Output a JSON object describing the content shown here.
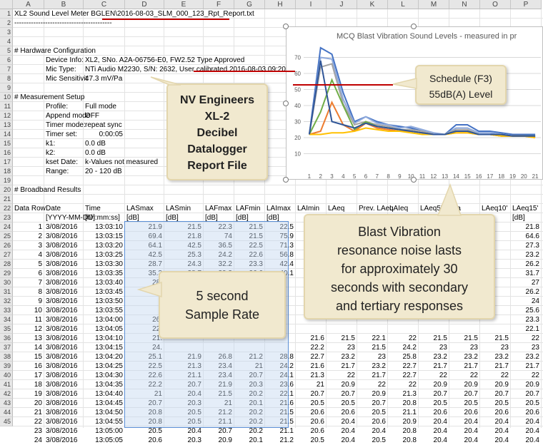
{
  "columns": [
    "A",
    "B",
    "C",
    "D",
    "E",
    "F",
    "G",
    "H",
    "I",
    "J",
    "K",
    "L",
    "M",
    "N",
    "O",
    "P"
  ],
  "header_rows": [
    {
      "row": 1,
      "cells": [
        {
          "col": "A",
          "text": "XL2 Sound Level Meter BGLEN\\2016-08-03_SLM_000_123_Rpt_Report.txt"
        }
      ]
    },
    {
      "row": 2,
      "cells": [
        {
          "col": "A",
          "text": "-----------------------------------------"
        }
      ]
    },
    {
      "row": 3,
      "cells": []
    },
    {
      "row": 4,
      "cells": []
    },
    {
      "row": 5,
      "cells": [
        {
          "col": "A",
          "text": "# Hardware Configuration"
        }
      ]
    },
    {
      "row": 6,
      "cells": [
        {
          "col": "B",
          "text": "Device Info:"
        },
        {
          "col": "C",
          "text": "XL2, SNo. A2A-06756-E0, FW2.52 Type Approved"
        }
      ]
    },
    {
      "row": 7,
      "cells": [
        {
          "col": "B",
          "text": "Mic Type:"
        },
        {
          "col": "C",
          "text": "NTi Audio M2230, S/N: 2632, User calibrated 2016-08-03  09:20"
        }
      ]
    },
    {
      "row": 8,
      "cells": [
        {
          "col": "B",
          "text": "Mic Sensitivit"
        },
        {
          "col": "C",
          "text": "47.3 mV/Pa"
        }
      ]
    },
    {
      "row": 9,
      "cells": []
    },
    {
      "row": 10,
      "cells": [
        {
          "col": "A",
          "text": "# Measurement Setup"
        }
      ]
    },
    {
      "row": 11,
      "cells": [
        {
          "col": "B",
          "text": "Profile:"
        },
        {
          "col": "C",
          "text": "Full mode"
        }
      ]
    },
    {
      "row": 12,
      "cells": [
        {
          "col": "B",
          "text": "Append mode"
        },
        {
          "col": "C",
          "text": "OFF"
        }
      ]
    },
    {
      "row": 13,
      "cells": [
        {
          "col": "B",
          "text": "Timer mode:"
        },
        {
          "col": "C",
          "text": "repeat sync"
        }
      ]
    },
    {
      "row": 14,
      "cells": [
        {
          "col": "B",
          "text": "Timer set:"
        },
        {
          "col": "C",
          "text": "0:00:05",
          "align": "right"
        }
      ]
    },
    {
      "row": 15,
      "cells": [
        {
          "col": "B",
          "text": "k1:"
        },
        {
          "col": "C",
          "text": "0.0 dB"
        }
      ]
    },
    {
      "row": 16,
      "cells": [
        {
          "col": "B",
          "text": "k2:"
        },
        {
          "col": "C",
          "text": "0.0 dB"
        }
      ]
    },
    {
      "row": 17,
      "cells": [
        {
          "col": "B",
          "text": "kset Date:"
        },
        {
          "col": "C",
          "text": "k-Values not measured"
        }
      ]
    },
    {
      "row": 18,
      "cells": [
        {
          "col": "B",
          "text": "Range:"
        },
        {
          "col": "C",
          "text": "20 - 120 dB"
        }
      ]
    },
    {
      "row": 19,
      "cells": []
    },
    {
      "row": 20,
      "cells": [
        {
          "col": "A",
          "text": "# Broadband Results"
        }
      ]
    },
    {
      "row": 21,
      "cells": []
    },
    {
      "row": 22,
      "cells": [
        {
          "col": "A",
          "text": "Data Row"
        },
        {
          "col": "B",
          "text": "Date"
        },
        {
          "col": "C",
          "text": "Time"
        },
        {
          "col": "D",
          "text": "LASmax"
        },
        {
          "col": "E",
          "text": "LASmin"
        },
        {
          "col": "F",
          "text": "LAFmax"
        },
        {
          "col": "G",
          "text": "LAFmin"
        },
        {
          "col": "H",
          "text": "LAImax"
        },
        {
          "col": "I",
          "text": "LAImin"
        },
        {
          "col": "J",
          "text": "LAeq"
        },
        {
          "col": "K",
          "text": "Prev. LAeq"
        },
        {
          "col": "L",
          "text": "LAIeq"
        },
        {
          "col": "M",
          "text": "LAeq5\""
        },
        {
          "col": "N",
          "text": "ma"
        },
        {
          "col": "O",
          "text": "LAeq10'"
        },
        {
          "col": "P",
          "text": "LAeq15'"
        }
      ]
    },
    {
      "row": 23,
      "cells": [
        {
          "col": "B",
          "text": "[YYYY-MM-DD]"
        },
        {
          "col": "C",
          "text": "[hh:mm:ss]"
        },
        {
          "col": "D",
          "text": "[dB]"
        },
        {
          "col": "E",
          "text": "[dB]"
        },
        {
          "col": "F",
          "text": "[dB]"
        },
        {
          "col": "G",
          "text": "[dB]"
        },
        {
          "col": "H",
          "text": "[dB]"
        },
        {
          "col": "P",
          "text": "[dB]"
        }
      ]
    }
  ],
  "data_rows": [
    {
      "row": 24,
      "v": [
        "1",
        "3/08/2016",
        "13:03:10",
        "21.9",
        "21.5",
        "22.3",
        "21.5",
        "22.5",
        "",
        "",
        "",
        "",
        "",
        "",
        "",
        "21.8"
      ]
    },
    {
      "row": 25,
      "v": [
        "2",
        "3/08/2016",
        "13:03:15",
        "69.4",
        "21.8",
        "74",
        "21.5",
        "75.9",
        "",
        "",
        "",
        "",
        "",
        "",
        "",
        "64.6"
      ]
    },
    {
      "row": 26,
      "v": [
        "3",
        "3/08/2016",
        "13:03:20",
        "64.1",
        "42.5",
        "36.5",
        "22.5",
        "71.3",
        "",
        "",
        "",
        "",
        "",
        "",
        "",
        "27.3"
      ]
    },
    {
      "row": 27,
      "v": [
        "4",
        "3/08/2016",
        "13:03:25",
        "42.5",
        "25.3",
        "24.2",
        "22.6",
        "56.8",
        "",
        "",
        "",
        "",
        "",
        "",
        "",
        "23.2"
      ]
    },
    {
      "row": 28,
      "v": [
        "5",
        "3/08/2016",
        "13:03:30",
        "28.7",
        "24.3",
        "32.2",
        "23.3",
        "42.4",
        "",
        "",
        "",
        "",
        "",
        "",
        "",
        "26.2"
      ]
    },
    {
      "row": 29,
      "v": [
        "6",
        "3/08/2016",
        "13:03:35",
        "35.3",
        "28.7",
        "39.3",
        "26.6",
        "40.1",
        "",
        "",
        "",
        "",
        "",
        "",
        "",
        "31.7"
      ]
    },
    {
      "row": 30,
      "v": [
        "7",
        "3/08/2016",
        "13:03:40",
        "28.",
        "",
        "",
        "",
        "",
        "",
        "",
        "",
        "",
        "",
        "",
        "",
        "27"
      ]
    },
    {
      "row": 31,
      "v": [
        "8",
        "3/08/2016",
        "13:03:45",
        "27.",
        "",
        "",
        "",
        "",
        "",
        "",
        "",
        "",
        "",
        "",
        "",
        "26.2"
      ]
    },
    {
      "row": 32,
      "v": [
        "9",
        "3/08/2016",
        "13:03:50",
        "",
        "",
        "",
        "",
        "",
        "",
        "",
        "",
        "",
        "",
        "",
        "",
        "24"
      ]
    },
    {
      "row": 33,
      "v": [
        "10",
        "3/08/2016",
        "13:03:55",
        "",
        "",
        "",
        "",
        "",
        "",
        "",
        "",
        "",
        "",
        "",
        "",
        "25.6"
      ]
    },
    {
      "row": 34,
      "v": [
        "11",
        "3/08/2016",
        "13:04:00",
        "26.",
        "",
        "",
        "",
        "",
        "",
        "",
        "",
        "",
        "",
        "",
        "",
        "23.3"
      ]
    },
    {
      "row": 35,
      "v": [
        "12",
        "3/08/2016",
        "13:04:05",
        "22.",
        "",
        "",
        "",
        "",
        "",
        "",
        "",
        "",
        "",
        "",
        "",
        "22.1"
      ]
    },
    {
      "row": 36,
      "v": [
        "13",
        "3/08/2016",
        "13:04:10",
        "21.",
        "",
        "",
        "",
        "",
        "21.6",
        "21.5",
        "22.1",
        "22",
        "21.5",
        "21.5",
        "21.5",
        "22"
      ]
    },
    {
      "row": 37,
      "v": [
        "14",
        "3/08/2016",
        "13:04:15",
        "24.",
        "",
        "",
        "",
        "",
        "22.2",
        "23",
        "21.5",
        "24.2",
        "23",
        "23",
        "23",
        "23"
      ]
    },
    {
      "row": 38,
      "v": [
        "15",
        "3/08/2016",
        "13:04:20",
        "25.1",
        "21.9",
        "26.8",
        "21.2",
        "28.8",
        "22.7",
        "23.2",
        "23",
        "25.8",
        "23.2",
        "23.2",
        "23.2",
        "23.2"
      ]
    },
    {
      "row": 39,
      "v": [
        "16",
        "3/08/2016",
        "13:04:25",
        "22.5",
        "21.3",
        "23.4",
        "21",
        "24.2",
        "21.6",
        "21.7",
        "23.2",
        "22.7",
        "21.7",
        "21.7",
        "21.7",
        "21.7"
      ]
    },
    {
      "row": 40,
      "v": [
        "17",
        "3/08/2016",
        "13:04:30",
        "22.6",
        "21.1",
        "23.4",
        "20.7",
        "24.1",
        "21.3",
        "22",
        "21.7",
        "22.7",
        "22",
        "22",
        "22",
        "22"
      ]
    },
    {
      "row": 41,
      "v": [
        "18",
        "3/08/2016",
        "13:04:35",
        "22.2",
        "20.7",
        "21.9",
        "20.3",
        "23.6",
        "21",
        "20.9",
        "22",
        "22",
        "20.9",
        "20.9",
        "20.9",
        "20.9"
      ]
    },
    {
      "row": 42,
      "v": [
        "19",
        "3/08/2016",
        "13:04:40",
        "21",
        "20.4",
        "21.5",
        "20.2",
        "22.1",
        "20.7",
        "20.7",
        "20.9",
        "21.3",
        "20.7",
        "20.7",
        "20.7",
        "20.7"
      ]
    },
    {
      "row": 43,
      "v": [
        "20",
        "3/08/2016",
        "13:04:45",
        "20.7",
        "20.3",
        "21",
        "20.1",
        "21.6",
        "20.5",
        "20.5",
        "20.7",
        "20.8",
        "20.5",
        "20.5",
        "20.5",
        "20.5"
      ]
    },
    {
      "row": 44,
      "v": [
        "21",
        "3/08/2016",
        "13:04:50",
        "20.8",
        "20.5",
        "21.2",
        "20.2",
        "21.5",
        "20.6",
        "20.6",
        "20.5",
        "21.1",
        "20.6",
        "20.6",
        "20.6",
        "20.6"
      ]
    },
    {
      "row": 45,
      "v": [
        "22",
        "3/08/2016",
        "13:04:55",
        "20.8",
        "20.5",
        "21.1",
        "20.2",
        "21.5",
        "20.6",
        "20.4",
        "20.6",
        "20.9",
        "20.4",
        "20.4",
        "20.4",
        "20.4"
      ]
    },
    {
      "row": 46,
      "v": [
        "23",
        "3/08/2016",
        "13:05:00",
        "20.5",
        "20.4",
        "20.7",
        "20.2",
        "21.1",
        "20.6",
        "20.4",
        "20.4",
        "20.8",
        "20.4",
        "20.4",
        "20.4",
        "20.4"
      ]
    },
    {
      "row": 47,
      "v": [
        "24",
        "3/08/2016",
        "13:05:05",
        "20.6",
        "20.3",
        "20.9",
        "20.1",
        "21.2",
        "20.5",
        "20.4",
        "20.5",
        "20.8",
        "20.4",
        "20.4",
        "20.4",
        "20.4"
      ]
    }
  ],
  "callouts": {
    "engineers": [
      "NV Engineers",
      "XL-2",
      "Decibel",
      "Datalogger",
      "Report File"
    ],
    "schedule": [
      "Schedule (F3)",
      "55dB(A) Level"
    ],
    "blast": [
      "Blast Vibration",
      "resonance noise lasts",
      "for approximately 30",
      "seconds with secondary",
      "and tertiary responses"
    ],
    "sample": [
      "5 second",
      "Sample Rate"
    ]
  },
  "chart_data": {
    "type": "line",
    "title": "MCQ Blast Vibration Sound Levels - measured in pr",
    "x": [
      1,
      2,
      3,
      4,
      5,
      6,
      7,
      8,
      9,
      10,
      11,
      12,
      13,
      14,
      15,
      16,
      17,
      18,
      19,
      20,
      21
    ],
    "ylim": [
      0,
      80
    ],
    "yticks": [
      10,
      20,
      30,
      40,
      50,
      60,
      70
    ],
    "grid": true,
    "series": [
      {
        "color": "#4472c4",
        "values": [
          22,
          76,
          72,
          48,
          30,
          33,
          30,
          28,
          27,
          26,
          24,
          22,
          22,
          28,
          28,
          24,
          24,
          23,
          22,
          22,
          22
        ]
      },
      {
        "color": "#8faadc",
        "values": [
          22,
          70,
          69,
          44,
          29,
          33,
          29,
          28,
          26,
          27,
          25,
          23,
          22,
          26,
          26,
          23,
          23,
          22,
          21,
          21,
          21
        ]
      },
      {
        "color": "#a5a5a5",
        "values": [
          22,
          64,
          66,
          41,
          28,
          30,
          28,
          27,
          25,
          25,
          24,
          22,
          22,
          25,
          25,
          22,
          22,
          22,
          21,
          21,
          21
        ]
      },
      {
        "color": "#70ad47",
        "values": [
          22,
          36,
          56,
          40,
          25,
          30,
          27,
          26,
          25,
          24,
          23,
          22,
          22,
          24,
          24,
          22,
          22,
          21,
          21,
          21,
          21
        ]
      },
      {
        "color": "#ed7d31",
        "values": [
          22,
          24,
          42,
          28,
          24,
          29,
          26,
          25,
          24,
          24,
          23,
          22,
          22,
          23,
          23,
          22,
          22,
          21,
          21,
          21,
          20
        ]
      },
      {
        "color": "#ffc000",
        "values": [
          22,
          22,
          23,
          23,
          24,
          26,
          25,
          24,
          24,
          23,
          22,
          22,
          22,
          23,
          23,
          22,
          22,
          21,
          21,
          21,
          20
        ]
      },
      {
        "color": "#2f5597",
        "values": [
          22,
          68,
          30,
          28,
          26,
          29,
          27,
          26,
          25,
          24,
          23,
          22,
          22,
          24,
          24,
          22,
          22,
          22,
          21,
          21,
          21
        ]
      }
    ]
  }
}
